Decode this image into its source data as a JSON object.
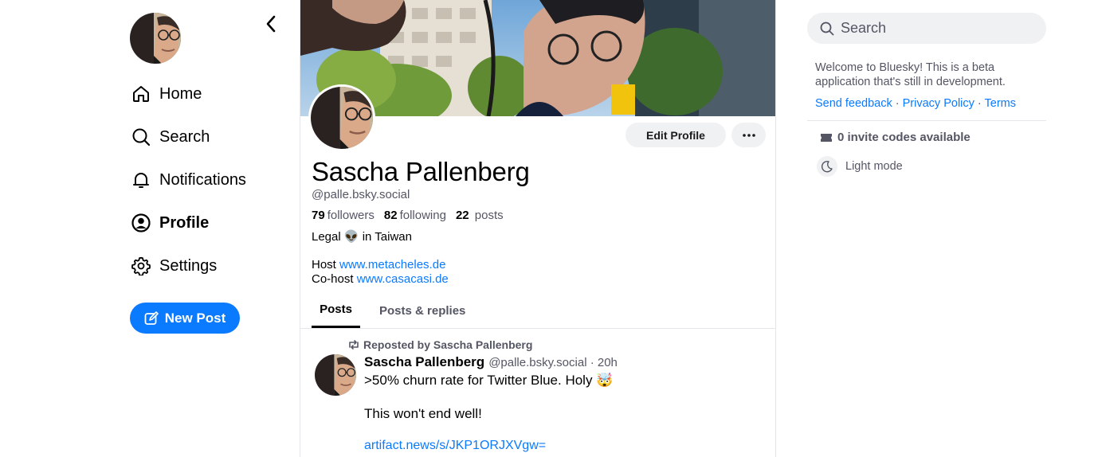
{
  "nav": {
    "items": [
      {
        "label": "Home",
        "icon": "home-icon"
      },
      {
        "label": "Search",
        "icon": "search-icon"
      },
      {
        "label": "Notifications",
        "icon": "bell-icon"
      },
      {
        "label": "Profile",
        "icon": "user-circle-icon",
        "active": true
      },
      {
        "label": "Settings",
        "icon": "gear-icon"
      }
    ],
    "new_post_label": "New Post"
  },
  "profile": {
    "display_name": "Sascha Pallenberg",
    "handle": "@palle.bsky.social",
    "followers_count": "79",
    "followers_label": "followers",
    "following_count": "82",
    "following_label": "following",
    "posts_count": "22",
    "posts_label": "posts",
    "bio_line1": "Legal 👽 in Taiwan",
    "host_prefix": "Host ",
    "host_link": "www.metacheles.de",
    "cohost_prefix": "Co-host ",
    "cohost_link": "www.casacasi.de",
    "edit_label": "Edit Profile"
  },
  "tabs": [
    {
      "label": "Posts",
      "active": true
    },
    {
      "label": "Posts & replies"
    }
  ],
  "post": {
    "repost_text": "Reposted by Sascha Pallenberg",
    "author": "Sascha Pallenberg",
    "meta": "@palle.bsky.social · 20h",
    "text1": ">50% churn rate for Twitter Blue. Holy 🤯",
    "text2": "This won't end well!",
    "link": "artifact.news/s/JKP1ORJXVgw="
  },
  "right": {
    "search_placeholder": "Search",
    "welcome": "Welcome to Bluesky! This is a beta application that's still in development.",
    "link_feedback": "Send feedback",
    "link_privacy": "Privacy Policy",
    "link_terms": "Terms",
    "separator": " · ",
    "invite": "0 invite codes available",
    "light_mode": "Light mode"
  },
  "colors": {
    "accent": "#0a7aff",
    "muted": "#545664",
    "pill_bg": "#f0f1f3"
  }
}
